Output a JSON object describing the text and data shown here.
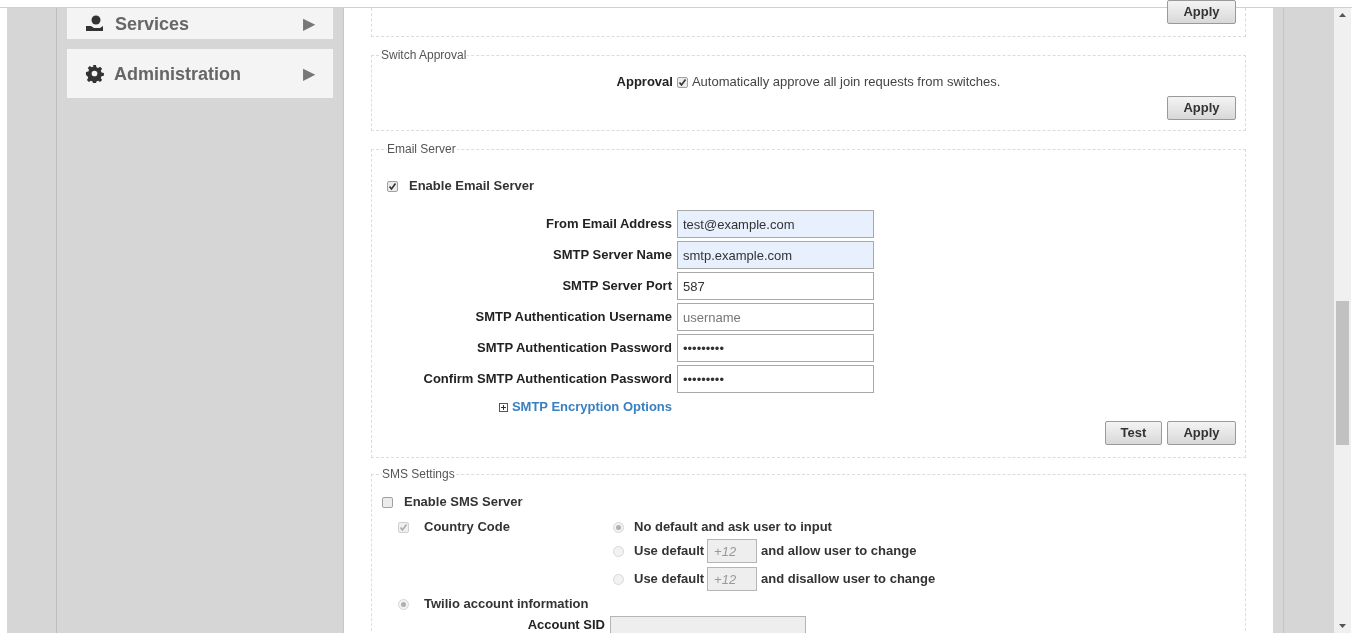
{
  "sidebar": {
    "items": [
      {
        "label": "Services",
        "arrow": "▶"
      },
      {
        "label": "Administration",
        "arrow": "▶"
      }
    ]
  },
  "previous_section": {
    "button": "Apply"
  },
  "switch_approval": {
    "legend": "Switch Approval",
    "label": "Approval",
    "checked": true,
    "description": "Automatically approve all join requests from switches.",
    "button": "Apply"
  },
  "email_server": {
    "legend": "Email Server",
    "enable": {
      "label": "Enable Email Server",
      "checked": true
    },
    "fields": [
      {
        "label": "From Email Address",
        "value": "test@example.com",
        "autofilled": true
      },
      {
        "label": "SMTP Server Name",
        "value": "smtp.example.com",
        "autofilled": true
      },
      {
        "label": "SMTP Server Port",
        "value": "587",
        "autofilled": false
      },
      {
        "label": "SMTP Authentication Username",
        "placeholder": "username",
        "autofilled": false
      },
      {
        "label": "SMTP Authentication Password",
        "value": "•••••••••",
        "autofilled": false
      },
      {
        "label": "Confirm SMTP Authentication Password",
        "value": "•••••••••",
        "autofilled": false
      }
    ],
    "encryption_link": {
      "label": "SMTP Encryption Options",
      "expanded": false
    },
    "buttons": [
      "Test",
      "Apply"
    ]
  },
  "sms_settings": {
    "legend": "SMS Settings",
    "enable": {
      "label": "Enable SMS Server",
      "checked": false
    },
    "country_code": {
      "label": "Country Code",
      "checked": true,
      "disabled": true
    },
    "options": [
      {
        "label": "No default and ask user to input",
        "selected": true,
        "disabled": true
      },
      {
        "prefix": "Use default",
        "placeholder": "+12",
        "suffix": "and allow user to change",
        "selected": false,
        "disabled": true
      },
      {
        "prefix": "Use default",
        "placeholder": "+12",
        "suffix": "and disallow user to change",
        "selected": false,
        "disabled": true
      }
    ],
    "twilio": {
      "label": "Twilio account information",
      "selected": true,
      "disabled": true
    },
    "account_sid": {
      "label": "Account SID"
    }
  }
}
